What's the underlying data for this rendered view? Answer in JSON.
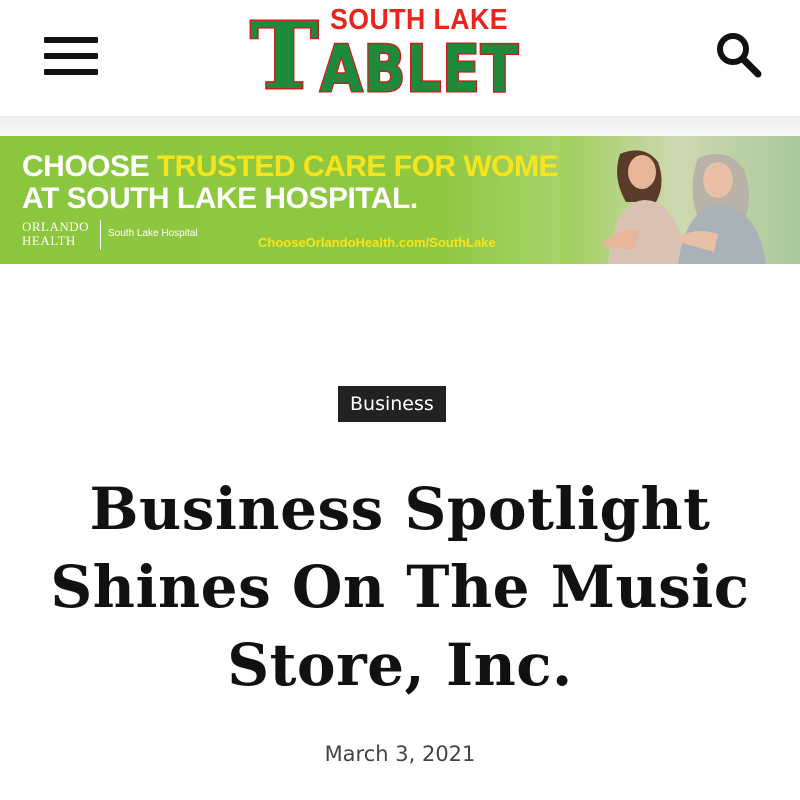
{
  "header": {
    "logo_top": "SOUTH LAKE",
    "logo_initial": "T",
    "logo_main": "ABLET"
  },
  "ad": {
    "line1_white": "CHOOSE ",
    "line1_highlight": "TRUSTED CARE FOR WOMEN",
    "line2": "AT SOUTH LAKE HOSPITAL.",
    "org_name": "ORLANDO HEALTH",
    "hospital": "South Lake Hospital",
    "url": "ChooseOrlandoHealth.com/SouthLake",
    "colors": {
      "background": "#8cc63f",
      "highlight": "#f8e41a"
    }
  },
  "article": {
    "category": "Business",
    "title": "Business Spotlight Shines On The Music Store, Inc.",
    "date": "March 3, 2021"
  },
  "icons": {
    "menu": "hamburger-menu-icon",
    "search": "search-icon"
  },
  "colors": {
    "logo_green": "#1e8a3c",
    "logo_red": "#e8241c",
    "category_bg": "#222222"
  }
}
